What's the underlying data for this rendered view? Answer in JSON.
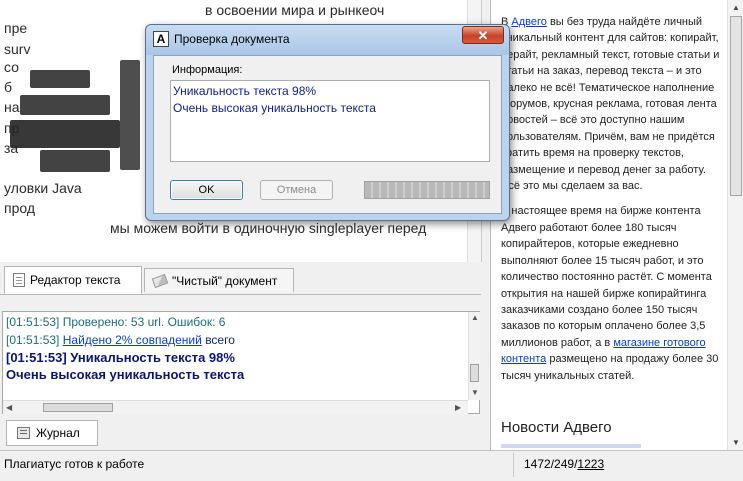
{
  "editor": {
    "lines": [
      "в освоении мира и рынкеоч",
      "пре",
      "surv",
      "со",
      "б",
      "на",
      "пр",
      "за",
      "уловки Java",
      "прод",
      "мы можем войти в одиночную singleplayer перед"
    ]
  },
  "tabs": {
    "editor_tab": "Редактор текста",
    "clean_tab": "\"Чистый\" документ"
  },
  "log": {
    "line1": "[01:51:53] Проверено: 53 url. Ошибок: 6",
    "line2_time": "[01:51:53]",
    "line2_link": "Найдено 2% совпадений",
    "line2_tail": "всего",
    "line3": "[01:51:53] Уникальность текста 98%",
    "line4": "Очень высокая уникальность текста"
  },
  "journal_tab": "Журнал",
  "right_panel": {
    "p1_start": "В ",
    "p1_link": "Адвего",
    "p1_rest": " вы без труда найдёте личный уникальный контент для сайтов: копирайт, рерайт, рекламный текст, готовые статьи и статьи на заказ, перевод текста – и это далеко не всё! Тематическое наполнение форумов, крусная реклама, готовая лента новостей – всё это доступно нашим пользователям. Причём, вам не придётся тратить время на проверку текстов, размещение и перевод денег за работу. Всё это мы сделаем за вас.",
    "p2_text": "В настоящее время на бирже контента Адвего работают более 180 тысяч копирайтеров, которые ежедневно выполняют более 15 тысяч работ, и это количество постоянно растёт. С момента открытия на нашей бирже копирайтинга заказчиками создано более 150 тысяч заказов по которым оплачено более 3,5 миллионов работ, а в ",
    "p2_link": "магазине готового контента",
    "p2_end": " размещено на продажу более 30 тысяч уникальных статей.",
    "news_heading": "Новости Адвего"
  },
  "status": {
    "left": "Плагиатус готов к работе",
    "count1": "1472",
    "sep1": " / ",
    "count2": "249",
    "sep2": " / ",
    "count3": "1223"
  },
  "dialog": {
    "icon_letter": "A",
    "title": "Проверка документа",
    "close_label": "✕",
    "info_label": "Информация:",
    "info_line1": "Уникальность текста 98%",
    "info_line2": "Очень высокая уникальность текста",
    "ok_label": "OK",
    "cancel_label": "Отмена",
    "progress_fraction": 1.0
  },
  "icons": {
    "editor_tab_icon": "document-icon",
    "clean_tab_icon": "eraser-icon",
    "journal_icon": "journal-icon",
    "app_icon": "advego-icon"
  }
}
